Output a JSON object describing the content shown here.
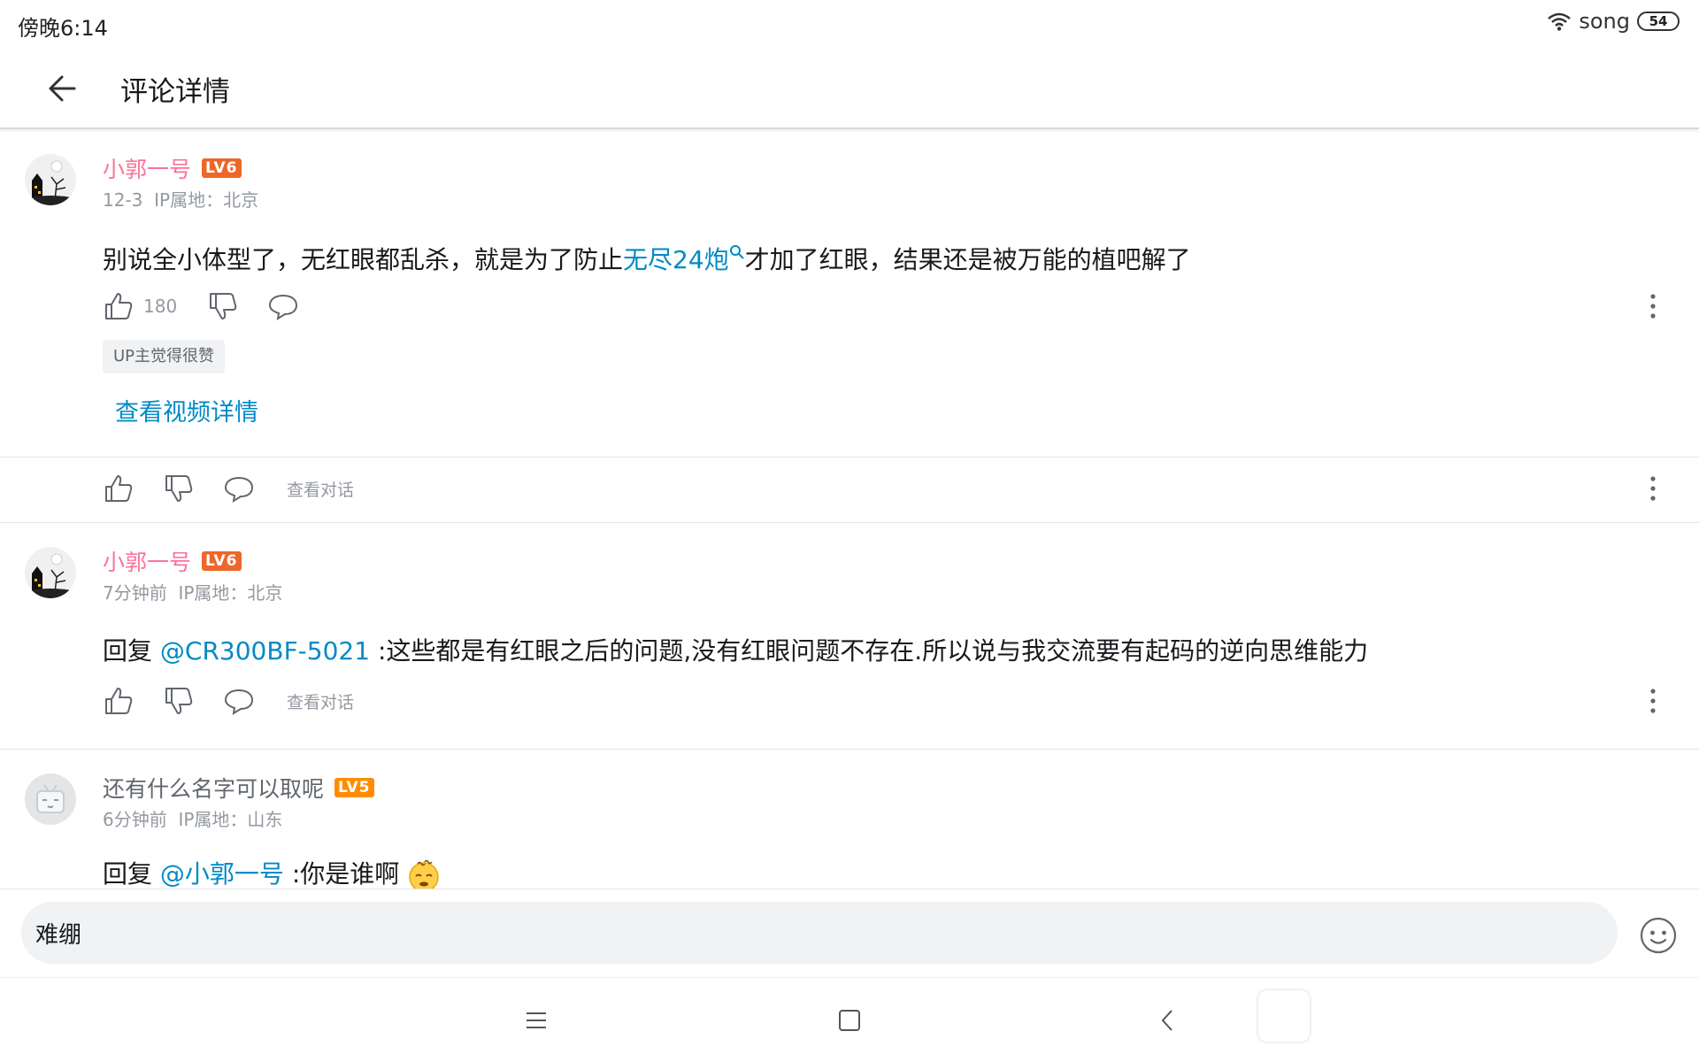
{
  "status_bar": {
    "time": "傍晚6:14",
    "carrier": "song",
    "battery": "54",
    "wifi_icon": "wifi-icon"
  },
  "header": {
    "title": "评论详情",
    "back_icon": "arrow-left-icon"
  },
  "root_comment": {
    "username": "小郭一号",
    "level": "LV6",
    "level_color": "#ee672a",
    "date": "12-3",
    "ip": "IP属地：北京",
    "content_before": "别说全小体型了，无红眼都乱杀，就是为了防止",
    "keyword": "无尽24炮",
    "content_after": "才加了红眼，结果还是被万能的植吧解了",
    "likes": "180",
    "up_tag": "UP主觉得很赞",
    "video_link": "查看视频详情"
  },
  "root_actions": {
    "view_conversation": "查看对话"
  },
  "replies": [
    {
      "username": "小郭一号",
      "level": "LV6",
      "level_color": "#ee672a",
      "time": "7分钟前",
      "ip": "IP属地：北京",
      "reply_prefix": "回复",
      "mention": "@CR300BF-5021",
      "text": " :这些都是有红眼之后的问题,没有红眼问题不存在.所以说与我交流要有起码的逆向思维能力",
      "view_conversation": "查看对话"
    },
    {
      "username": "还有什么名字可以取呢",
      "level": "LV5",
      "level_color": "#ff8c00",
      "time": "6分钟前",
      "ip": "IP属地：山东",
      "reply_prefix": "回复",
      "mention": "@小郭一号",
      "text": " :你是谁啊",
      "emoji": "dizzy-face-emoji"
    }
  ],
  "input": {
    "value": "难绷",
    "emoji_icon": "smiley-icon"
  },
  "colors": {
    "username_vip": "#fb7299",
    "link": "#008ac5",
    "meta": "#9499a0"
  }
}
